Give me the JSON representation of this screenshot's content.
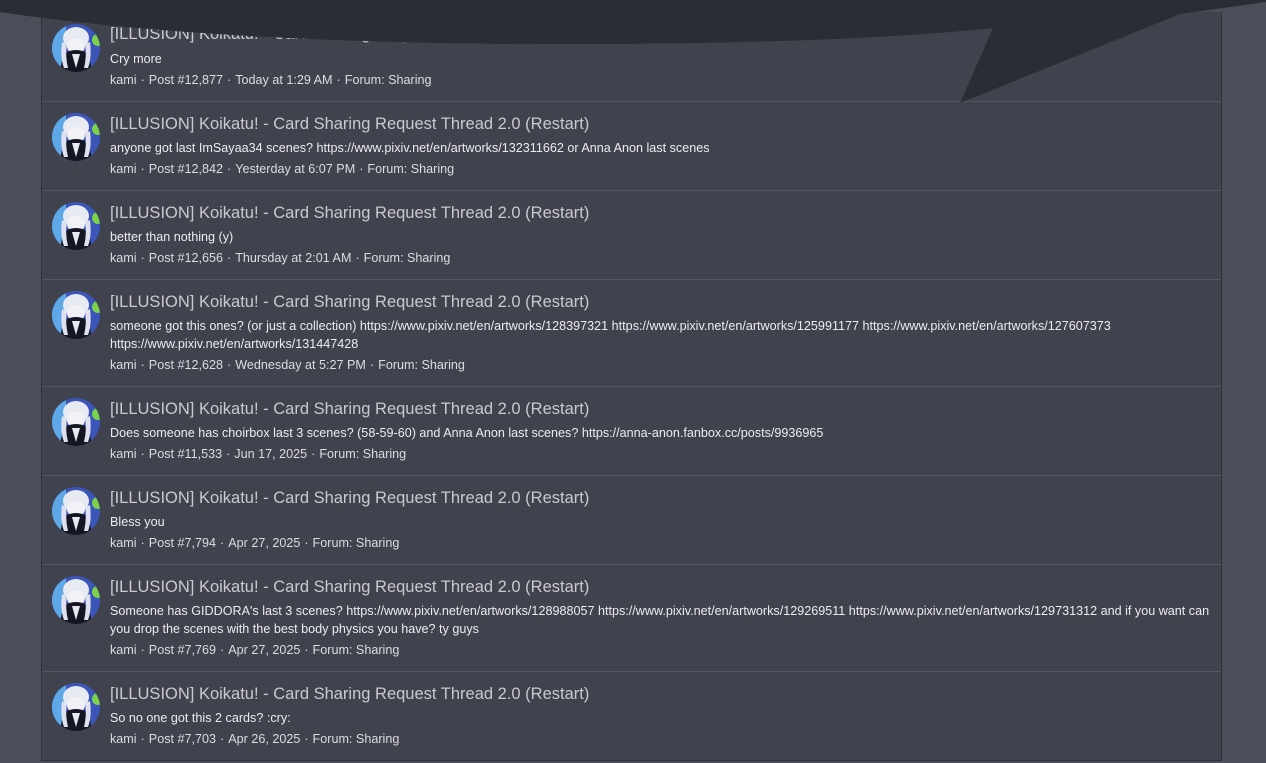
{
  "results": [
    {
      "title": "[ILLUSION] Koikatu! - Card Sharing Request Thread 2.0 (Restart)",
      "snippet": "Cry more",
      "author": "kami",
      "post": "Post #12,877",
      "date": "Today at 1:29 AM",
      "forum": "Forum: Sharing"
    },
    {
      "title": "[ILLUSION] Koikatu! - Card Sharing Request Thread 2.0 (Restart)",
      "snippet": "anyone got last ImSayaa34 scenes? https://www.pixiv.net/en/artworks/132311662 or Anna Anon last scenes",
      "author": "kami",
      "post": "Post #12,842",
      "date": "Yesterday at 6:07 PM",
      "forum": "Forum: Sharing"
    },
    {
      "title": "[ILLUSION] Koikatu! - Card Sharing Request Thread 2.0 (Restart)",
      "snippet": "better than nothing (y)",
      "author": "kami",
      "post": "Post #12,656",
      "date": "Thursday at 2:01 AM",
      "forum": "Forum: Sharing"
    },
    {
      "title": "[ILLUSION] Koikatu! - Card Sharing Request Thread 2.0 (Restart)",
      "snippet": "someone got this ones? (or just a collection) https://www.pixiv.net/en/artworks/128397321 https://www.pixiv.net/en/artworks/125991177 https://www.pixiv.net/en/artworks/127607373 https://www.pixiv.net/en/artworks/131447428",
      "author": "kami",
      "post": "Post #12,628",
      "date": "Wednesday at 5:27 PM",
      "forum": "Forum: Sharing"
    },
    {
      "title": "[ILLUSION] Koikatu! - Card Sharing Request Thread 2.0 (Restart)",
      "snippet": "Does someone has choirbox last 3 scenes? (58-59-60) and Anna Anon last scenes? https://anna-anon.fanbox.cc/posts/9936965",
      "author": "kami",
      "post": "Post #11,533",
      "date": "Jun 17, 2025",
      "forum": "Forum: Sharing"
    },
    {
      "title": "[ILLUSION] Koikatu! - Card Sharing Request Thread 2.0 (Restart)",
      "snippet": "Bless you",
      "author": "kami",
      "post": "Post #7,794",
      "date": "Apr 27, 2025",
      "forum": "Forum: Sharing"
    },
    {
      "title": "[ILLUSION] Koikatu! - Card Sharing Request Thread 2.0 (Restart)",
      "snippet": "Someone has GIDDORA's last 3 scenes? https://www.pixiv.net/en/artworks/128988057 https://www.pixiv.net/en/artworks/129269511 https://www.pixiv.net/en/artworks/129731312 and if you want can you drop the scenes with the best body physics you have? ty guys",
      "author": "kami",
      "post": "Post #7,769",
      "date": "Apr 27, 2025",
      "forum": "Forum: Sharing"
    },
    {
      "title": "[ILLUSION] Koikatu! - Card Sharing Request Thread 2.0 (Restart)",
      "snippet": "So no one got this 2 cards? :cry:",
      "author": "kami",
      "post": "Post #7,703",
      "date": "Apr 26, 2025",
      "forum": "Forum: Sharing"
    }
  ],
  "meta_separator": "·",
  "colors": {
    "page_bg": "#4b4d59",
    "list_bg": "#40424e",
    "divider": "#545663",
    "title": "#c9c9cf",
    "text": "#ececf0",
    "overlay": "#2b2d34"
  }
}
